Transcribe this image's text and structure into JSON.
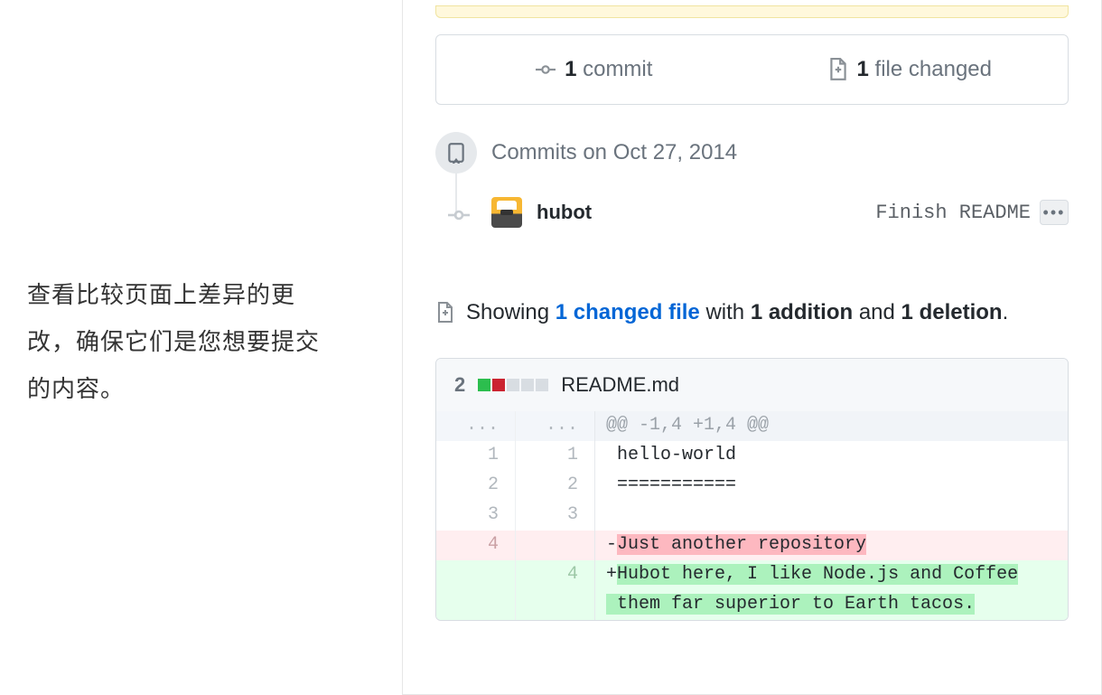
{
  "sidebar": {
    "description": "查看比较页面上差异的更改，确保它们是您想要提交的内容。"
  },
  "stats": {
    "commit_count": "1",
    "commit_label": "commit",
    "file_count": "1",
    "file_label": "file changed"
  },
  "timeline": {
    "date_label": "Commits on Oct 27, 2014",
    "author": "hubot",
    "commit_message": "Finish README",
    "kebab": "•••"
  },
  "summary": {
    "prefix": "Showing",
    "changed_link": "1 changed file",
    "mid1": "with",
    "additions": "1 addition",
    "mid2": "and",
    "deletions": "1 deletion",
    "suffix": "."
  },
  "diff_header": {
    "count": "2",
    "filename": "README.md"
  },
  "diff_lines": {
    "hunk_l": "...",
    "hunk_r": "...",
    "hunk_code": "@@ -1,4 +1,4 @@",
    "l1_old": "1",
    "l1_new": "1",
    "l1_code": " hello-world",
    "l2_old": "2",
    "l2_new": "2",
    "l2_code": " ===========",
    "l3_old": "3",
    "l3_new": "3",
    "l3_code": " ",
    "l4_old": "4",
    "l4_new": "",
    "l4_prefix": "-",
    "l4_code": "Just another repository",
    "l5_old": "",
    "l5_new": "4",
    "l5_prefix": "+",
    "l5_code": "Hubot here, I like Node.js and Coffee",
    "l6_code": " them far superior to Earth tacos."
  }
}
